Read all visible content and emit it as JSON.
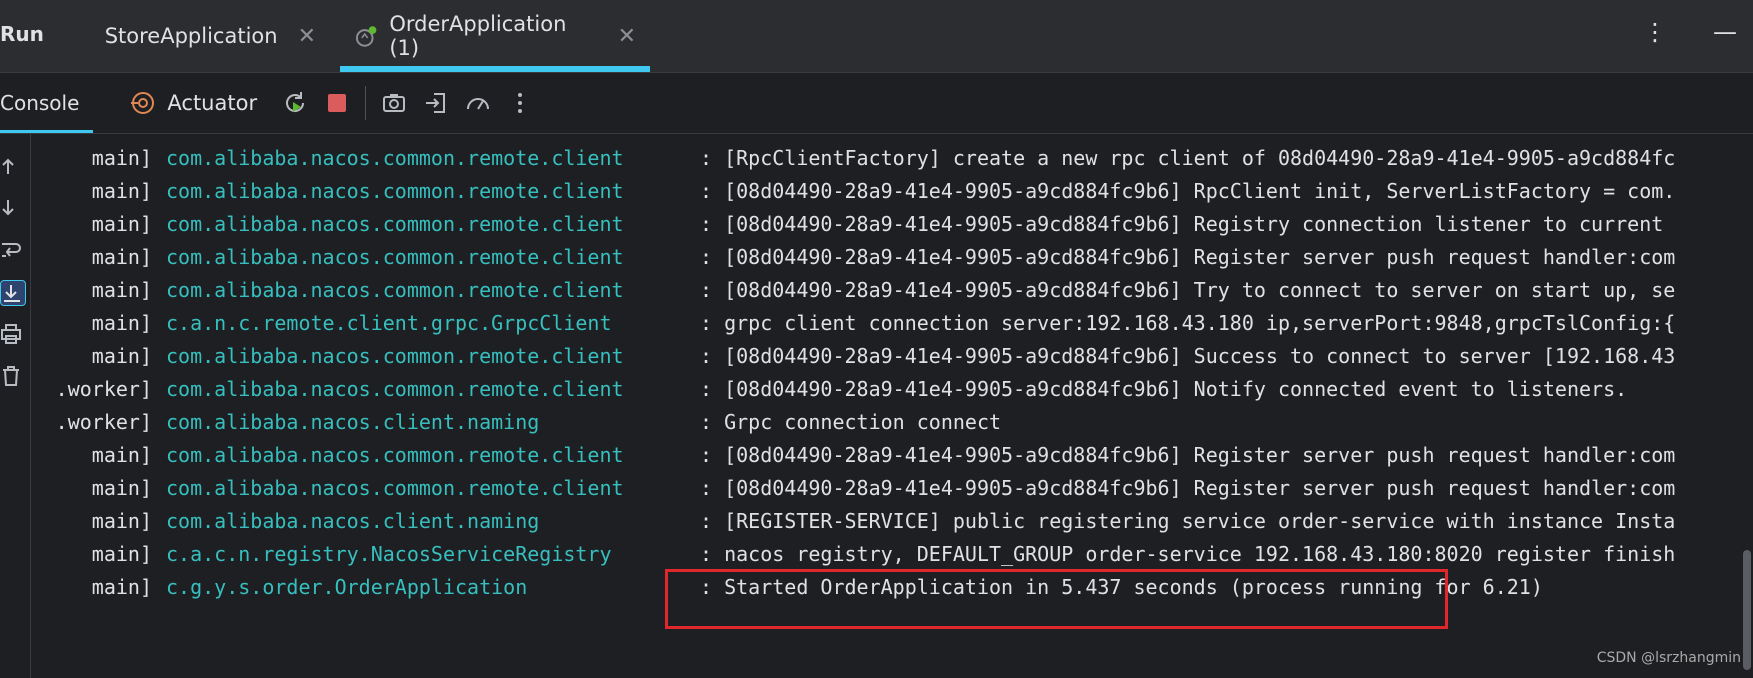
{
  "topbar": {
    "run_label": "Run",
    "tabs": [
      {
        "label": "StoreApplication"
      },
      {
        "label": "OrderApplication (1)"
      }
    ],
    "close_glyph": "✕",
    "more_glyph": "⋮",
    "minimize_glyph": "—"
  },
  "toolbar": {
    "console_label": "Console",
    "actuator_label": "Actuator",
    "icons": [
      "rerun-icon",
      "stop-icon",
      "screenshot-icon",
      "login-icon",
      "dashboard-icon",
      "more-icon"
    ]
  },
  "gutter_icons": [
    "arrow-up-icon",
    "arrow-down-icon",
    "soft-wrap-icon",
    "scroll-to-end-icon",
    "print-icon",
    "trash-icon"
  ],
  "accent_color": "#3fc8f0",
  "logger_color": "#37bfbf",
  "log_lines": [
    {
      "thread": "main]",
      "logger": "com.alibaba.nacos.common.remote.client",
      "message": ": [RpcClientFactory] create a new rpc client of 08d04490-28a9-41e4-9905-a9cd884fc"
    },
    {
      "thread": "main]",
      "logger": "com.alibaba.nacos.common.remote.client",
      "message": ": [08d04490-28a9-41e4-9905-a9cd884fc9b6] RpcClient init, ServerListFactory = com."
    },
    {
      "thread": "main]",
      "logger": "com.alibaba.nacos.common.remote.client",
      "message": ": [08d04490-28a9-41e4-9905-a9cd884fc9b6] Registry connection listener to current"
    },
    {
      "thread": "main]",
      "logger": "com.alibaba.nacos.common.remote.client",
      "message": ": [08d04490-28a9-41e4-9905-a9cd884fc9b6] Register server push request handler:com"
    },
    {
      "thread": "main]",
      "logger": "com.alibaba.nacos.common.remote.client",
      "message": ": [08d04490-28a9-41e4-9905-a9cd884fc9b6] Try to connect to server on start up, se"
    },
    {
      "thread": "main]",
      "logger": "c.a.n.c.remote.client.grpc.GrpcClient",
      "message": ": grpc client connection server:192.168.43.180 ip,serverPort:9848,grpcTslConfig:{"
    },
    {
      "thread": "main]",
      "logger": "com.alibaba.nacos.common.remote.client",
      "message": ": [08d04490-28a9-41e4-9905-a9cd884fc9b6] Success to connect to server [192.168.43"
    },
    {
      "thread": ".worker]",
      "logger": "com.alibaba.nacos.common.remote.client",
      "message": ": [08d04490-28a9-41e4-9905-a9cd884fc9b6] Notify connected event to listeners."
    },
    {
      "thread": ".worker]",
      "logger": "com.alibaba.nacos.client.naming",
      "message": ": Grpc connection connect"
    },
    {
      "thread": "main]",
      "logger": "com.alibaba.nacos.common.remote.client",
      "message": ": [08d04490-28a9-41e4-9905-a9cd884fc9b6] Register server push request handler:com"
    },
    {
      "thread": "main]",
      "logger": "com.alibaba.nacos.common.remote.client",
      "message": ": [08d04490-28a9-41e4-9905-a9cd884fc9b6] Register server push request handler:com"
    },
    {
      "thread": "main]",
      "logger": "com.alibaba.nacos.client.naming",
      "message": ": [REGISTER-SERVICE] public registering service order-service with instance Insta"
    },
    {
      "thread": "main]",
      "logger": "c.a.c.n.registry.NacosServiceRegistry",
      "message": ": nacos registry, DEFAULT_GROUP order-service 192.168.43.180:8020 register finish"
    },
    {
      "thread": "main]",
      "logger": "c.g.y.s.order.OrderApplication",
      "message": ": Started OrderApplication in 5.437 seconds (process running for 6.21)"
    }
  ],
  "highlight_color": "#e0282c",
  "watermark": "CSDN @lsrzhangmin"
}
